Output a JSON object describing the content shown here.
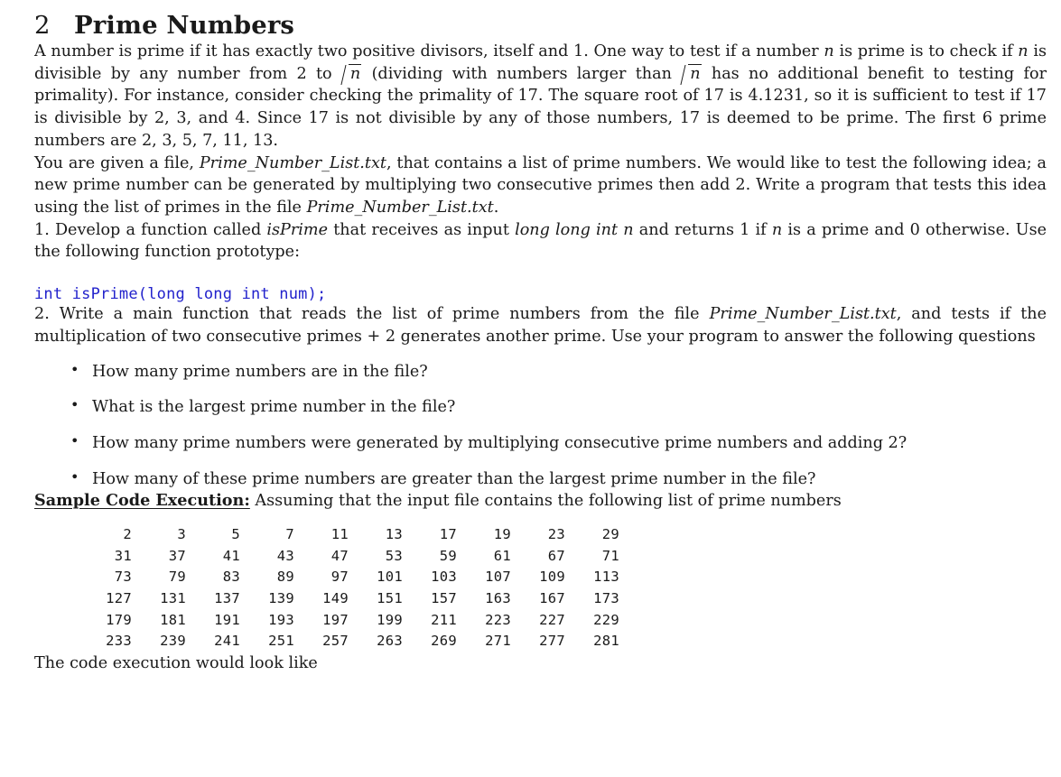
{
  "document": {
    "section": {
      "number": "2",
      "title": "Prime Numbers"
    },
    "paragraphs": {
      "intro_1": "A number is prime if it has exactly two positive divisors, itself and 1. One way to test if a number",
      "intro_2": "is prime is to check if",
      "intro_3": "is divisible by any number from 2 to",
      "intro_4": "(dividing with numbers larger than",
      "intro_5": "has no additional benefit to testing for primality). For instance, consider checking the primality of 17. The square root of 17 is 4.1231, so it is sufficient to test if 17 is divisible by 2, 3, and 4. Since 17 is not divisible by any of those numbers, 17 is deemed to be prime. The first 6 prime numbers are 2, 3, 5, 7, 11, 13.",
      "file_1": "You are given a file,",
      "file_filename": "Prime_Number_List.txt",
      "file_2": ", that contains a list of prime numbers. We would like to test the following idea; a new prime number can be generated by multiplying two consecutive primes then add 2. Write a program that tests this idea using the list of primes in the file",
      "file_filename_2": "Prime_Number_List.txt",
      "file_3": ".",
      "item1_a": "1. Develop a function called",
      "item1_isprime": "isPrime",
      "item1_b": "that receives as input",
      "item1_type": "long long int",
      "item1_n1": "n",
      "item1_c": "and returns 1 if",
      "item1_n2": "n",
      "item1_d": "is a prime and 0 otherwise. Use the following function prototype:",
      "item2_a": "2. Write a main function that reads the list of prime numbers from the file",
      "item2_filename": "Prime_Number_List.txt",
      "item2_b": ", and tests if the multiplication of two consecutive primes + 2 generates another prime. Use your program to answer the following questions",
      "sample_heading": "Sample Code Execution:",
      "sample_rest": "Assuming that the input file contains the following list of prime numbers",
      "closing": "The code execution would look like"
    },
    "code": {
      "line": "int isPrime(long long int num);",
      "color": "#2222cc"
    },
    "questions": [
      {
        "bullet": "•",
        "text": "How many prime numbers are in the file?"
      },
      {
        "bullet": "•",
        "text": "What is the largest prime number in the file?"
      },
      {
        "bullet": "•",
        "text": "How many prime numbers were generated by multiplying consecutive prime numbers and adding 2?"
      },
      {
        "bullet": "•",
        "text": "How many of these prime numbers are greater than the largest prime number in the file?"
      }
    ],
    "prime_table": {
      "rows": [
        [
          "2",
          "3",
          "5",
          "7",
          "11",
          "13",
          "17",
          "19",
          "23",
          "29"
        ],
        [
          "31",
          "37",
          "41",
          "43",
          "47",
          "53",
          "59",
          "61",
          "67",
          "71"
        ],
        [
          "73",
          "79",
          "83",
          "89",
          "97",
          "101",
          "103",
          "107",
          "109",
          "113"
        ],
        [
          "127",
          "131",
          "137",
          "139",
          "149",
          "151",
          "157",
          "163",
          "167",
          "173"
        ],
        [
          "179",
          "181",
          "191",
          "193",
          "197",
          "199",
          "211",
          "223",
          "227",
          "229"
        ],
        [
          "233",
          "239",
          "241",
          "251",
          "257",
          "263",
          "269",
          "271",
          "277",
          "281"
        ]
      ]
    },
    "math": {
      "sqrt_n": "n",
      "var_n": "n"
    }
  }
}
